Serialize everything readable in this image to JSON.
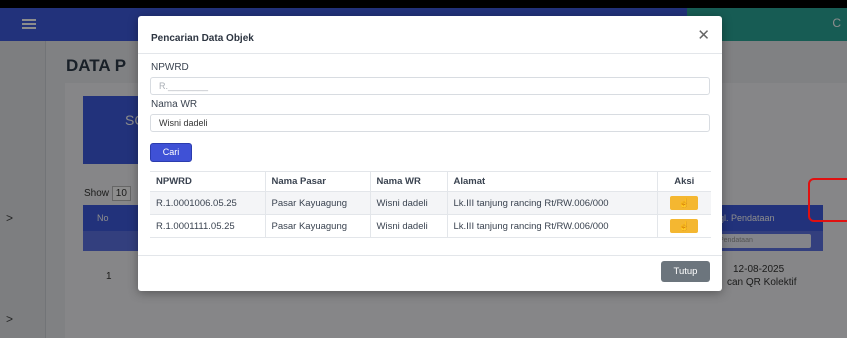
{
  "background": {
    "page_title": "DATA P",
    "card_fragment": "SC",
    "show_label": "Show",
    "show_value": "10",
    "table": {
      "col_no": "No",
      "col_tgl": "gl. Pendataan",
      "filter_placeholder": "Pendataan",
      "row_no": "1",
      "row_date": "12-08-2025",
      "row_method": "can QR Kolektif"
    },
    "topbar_glyph": "C",
    "side_arrow": ">"
  },
  "modal": {
    "title": "Pencarian Data Objek",
    "close_glyph": "✕",
    "npwrd_label": "NPWRD",
    "npwrd_placeholder": "R.________",
    "nama_wr_label": "Nama WR",
    "nama_wr_value": "Wisni dadeli",
    "cari_label": "Cari",
    "table": {
      "headers": [
        "NPWRD",
        "Nama Pasar",
        "Nama WR",
        "Alamat",
        "Aksi"
      ],
      "rows": [
        {
          "npwrd": "R.1.0001006.05.25",
          "nama_pasar": "Pasar Kayuagung",
          "nama_wr": "Wisni dadeli",
          "alamat": "Lk.III tanjung rancing Rt/RW.006/000"
        },
        {
          "npwrd": "R.1.0001111.05.25",
          "nama_pasar": "Pasar Kayuagung",
          "nama_wr": "Wisni dadeli",
          "alamat": "Lk.III tanjung rancing Rt/RW.006/000"
        }
      ],
      "aksi_icon": "pointer-hand-icon"
    },
    "tutup_label": "Tutup"
  },
  "colors": {
    "primary": "#3f5be0",
    "teal": "#2aa89a",
    "warning": "#f4b731",
    "secondary": "#6c757d",
    "highlight": "#e01010"
  }
}
